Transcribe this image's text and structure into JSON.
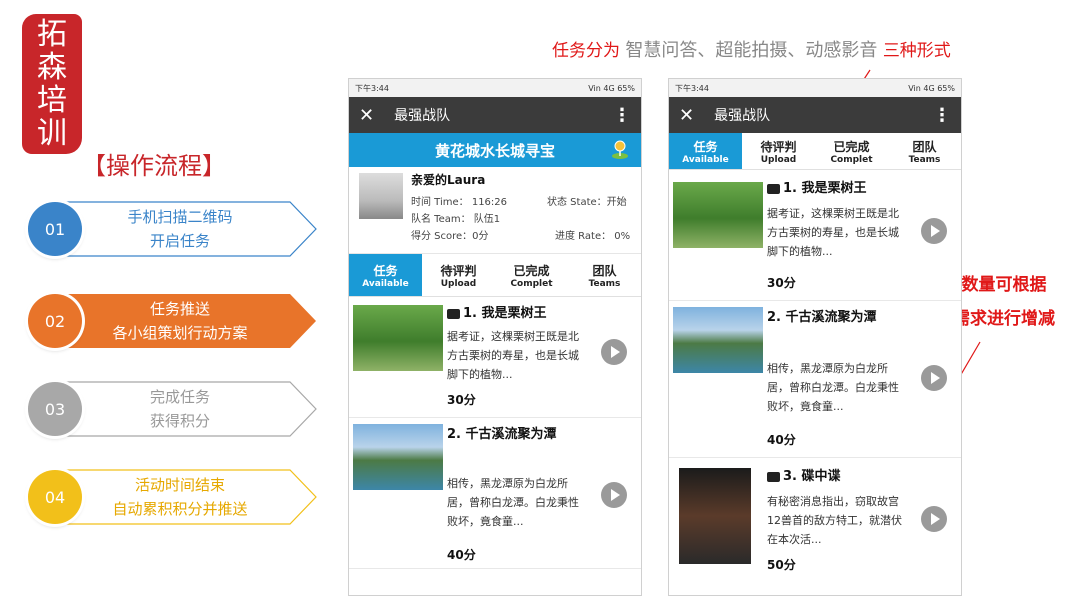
{
  "seal": {
    "chars": [
      "拓",
      "森",
      "培",
      "训"
    ]
  },
  "process_title": "【操作流程】",
  "steps": [
    {
      "num": "01",
      "line1": "手机扫描二维码",
      "line2": "开启任务",
      "color": "#3a84c9"
    },
    {
      "num": "02",
      "line1": "任务推送",
      "line2": "各小组策划行动方案",
      "color": "#e8742a"
    },
    {
      "num": "03",
      "line1": "完成任务",
      "line2": "获得积分",
      "color": "#a8a8a8"
    },
    {
      "num": "04",
      "line1": "活动时间结束",
      "line2": "自动累积积分并推送",
      "color": "#f2c01a"
    }
  ],
  "annotations": {
    "top_prefix": "任务分为",
    "top_middle": "智慧问答、超能拍摄、动感影音",
    "top_suffix": "三种形式",
    "side_line1": "任务数量可根据",
    "side_line2": "客户需求进行增减"
  },
  "phone1": {
    "status_time": "下午3:44",
    "status_right": "Vin 4G 65%",
    "app_title": "最强战队",
    "banner": "黄花城水长城寻宝",
    "profile": {
      "name": "亲爱的Laura",
      "time": "时间 Time： 116:26",
      "state": "状态 State：开始",
      "team": "队名 Team： 队伍1",
      "score": "得分 Score：0分",
      "rate": "进度 Rate： 0%"
    },
    "tabs": [
      {
        "cn": "任务",
        "en": "Available"
      },
      {
        "cn": "待评判",
        "en": "Upload"
      },
      {
        "cn": "已完成",
        "en": "Complet"
      },
      {
        "cn": "团队",
        "en": "Teams"
      }
    ],
    "tasks": [
      {
        "title": "1. 我是栗树王",
        "desc": "据考证，这棵栗树王既是北方古栗树的寿星，也是长城脚下的植物...",
        "points": "30分"
      },
      {
        "title": "2. 千古溪流聚为潭",
        "desc": "相传，黑龙潭原为白龙所居，曾称白龙潭。白龙秉性败坏，竟食童...",
        "points": "40分"
      }
    ]
  },
  "phone2": {
    "status_time": "下午3:44",
    "status_right": "Vin 4G 65%",
    "app_title": "最强战队",
    "tabs": [
      {
        "cn": "任务",
        "en": "Available"
      },
      {
        "cn": "待评判",
        "en": "Upload"
      },
      {
        "cn": "已完成",
        "en": "Complet"
      },
      {
        "cn": "团队",
        "en": "Teams"
      }
    ],
    "tasks": [
      {
        "title": "1. 我是栗树王",
        "desc": "据考证，这棵栗树王既是北方古栗树的寿星，也是长城脚下的植物...",
        "points": "30分"
      },
      {
        "title": "2. 千古溪流聚为潭",
        "desc": "相传，黑龙潭原为白龙所居，曾称白龙潭。白龙秉性败坏，竟食童...",
        "points": "40分"
      },
      {
        "title": "3. 碟中谍",
        "desc": "有秘密消息指出，窃取故宫12兽首的敌方特工，就潜伏在本次活...",
        "points": "50分"
      }
    ]
  }
}
